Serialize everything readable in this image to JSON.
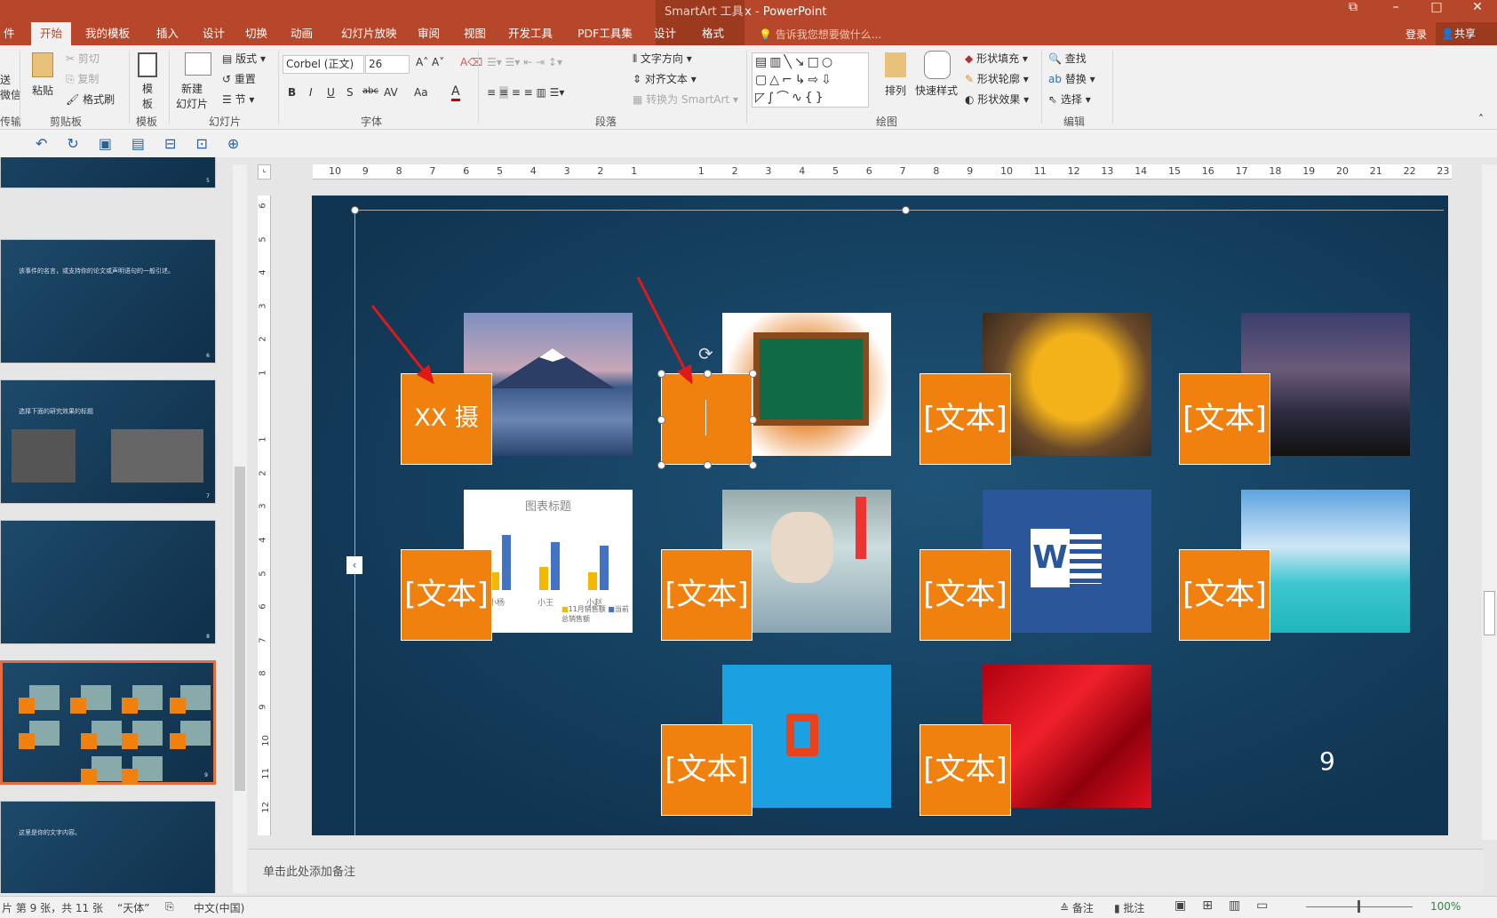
{
  "window": {
    "title": "PPT教程2.pptx - PowerPoint",
    "contextual": "SmartArt 工具",
    "controls": [
      "⧉",
      "–",
      "□",
      "✕"
    ]
  },
  "tabs": [
    "件",
    "开始",
    "我的模板",
    "插入",
    "设计",
    "切换",
    "动画",
    "幻灯片放映",
    "审阅",
    "视图",
    "开发工具",
    "PDF工具集",
    "设计",
    "格式"
  ],
  "tell_me": "告诉我您想要做什么...",
  "login": "登录",
  "share": "共享",
  "ribbon": {
    "clipboard": {
      "paste": "粘贴",
      "cut": "剪切",
      "copy": "复制",
      "painter": "格式刷",
      "label": "剪贴板",
      "send1": "送",
      "send2": "微信",
      "send_label": "传输"
    },
    "template": {
      "btn1": "模",
      "btn2": "板",
      "label": "模板"
    },
    "slides": {
      "new1": "新建",
      "new2": "幻灯片",
      "layout": "版式",
      "reset": "重置",
      "section": "节",
      "label": "幻灯片"
    },
    "font": {
      "name": "Corbel (正文)",
      "size": "26",
      "label": "字体",
      "bold": "B",
      "italic": "I",
      "underline": "U",
      "shadow": "S",
      "strike": "abc",
      "spacing": "AV",
      "case": "Aa",
      "color": "A"
    },
    "paragraph": {
      "direction": "文字方向",
      "align": "对齐文本",
      "convert": "转换为 SmartArt",
      "label": "段落"
    },
    "drawing": {
      "arrange": "排列",
      "quick": "快速样式",
      "fill": "形状填充",
      "outline": "形状轮廓",
      "effect": "形状效果",
      "label": "绘图"
    },
    "editing": {
      "find": "查找",
      "replace": "替换",
      "select": "选择",
      "label": "编辑"
    }
  },
  "ruler": {
    "h": [
      "10",
      "9",
      "8",
      "7",
      "6",
      "5",
      "4",
      "3",
      "2",
      "1",
      "",
      "1",
      "2",
      "3",
      "4",
      "5",
      "6",
      "7",
      "8",
      "9",
      "10",
      "11",
      "12",
      "13",
      "14",
      "15",
      "16",
      "17",
      "18",
      "19",
      "20",
      "21",
      "22",
      "23"
    ],
    "v": [
      "6",
      "5",
      "4",
      "3",
      "2",
      "1",
      "",
      "1",
      "2",
      "3",
      "4",
      "5",
      "6",
      "7",
      "8",
      "9",
      "10",
      "11",
      "12"
    ]
  },
  "thumbnails": [
    {
      "num": "5",
      "text": ""
    },
    {
      "num": "6",
      "text": "该事件的名言，或支持你的论文或声明语句的一般引述。"
    },
    {
      "num": "7",
      "text": "选择下面的研究效果的标题"
    },
    {
      "num": "8",
      "text": ""
    },
    {
      "num": "9",
      "text": ""
    },
    {
      "num": "10",
      "text": "这里是你的文字内容。"
    }
  ],
  "slide": {
    "tiles": [
      {
        "label": "XX 摄",
        "pic": "mount-fuji-photo"
      },
      {
        "label": "",
        "pic": "chalkboard-photo"
      },
      {
        "label": "[文本]",
        "pic": "autumn-leaf-photo"
      },
      {
        "label": "[文本]",
        "pic": "city-night-photo"
      },
      {
        "label": "[文本]",
        "pic": "chart-image"
      },
      {
        "label": "[文本]",
        "pic": "doctor-photo"
      },
      {
        "label": "[文本]",
        "pic": "word-logo-image"
      },
      {
        "label": "[文本]",
        "pic": "beach-photo"
      },
      {
        "label": "[文本]",
        "pic": "office-logo-image"
      },
      {
        "label": "[文本]",
        "pic": "red-silk-image"
      }
    ],
    "chart": {
      "title": "图表标题",
      "categories": [
        "小杨",
        "小王",
        "小赵"
      ],
      "legend": [
        "11月销售额",
        "当前总销售额"
      ]
    },
    "page_number": "9"
  },
  "notes_placeholder": "单击此处添加备注",
  "status": {
    "slide": "片 第 9 张，共 11 张",
    "theme": "“天体”",
    "lang": "中文(中国)",
    "notes": "备注",
    "comments": "批注",
    "zoom": "100%"
  },
  "colors": {
    "accent": "#b7472a",
    "orange": "#f0810f",
    "slide_bg": "#103552"
  }
}
